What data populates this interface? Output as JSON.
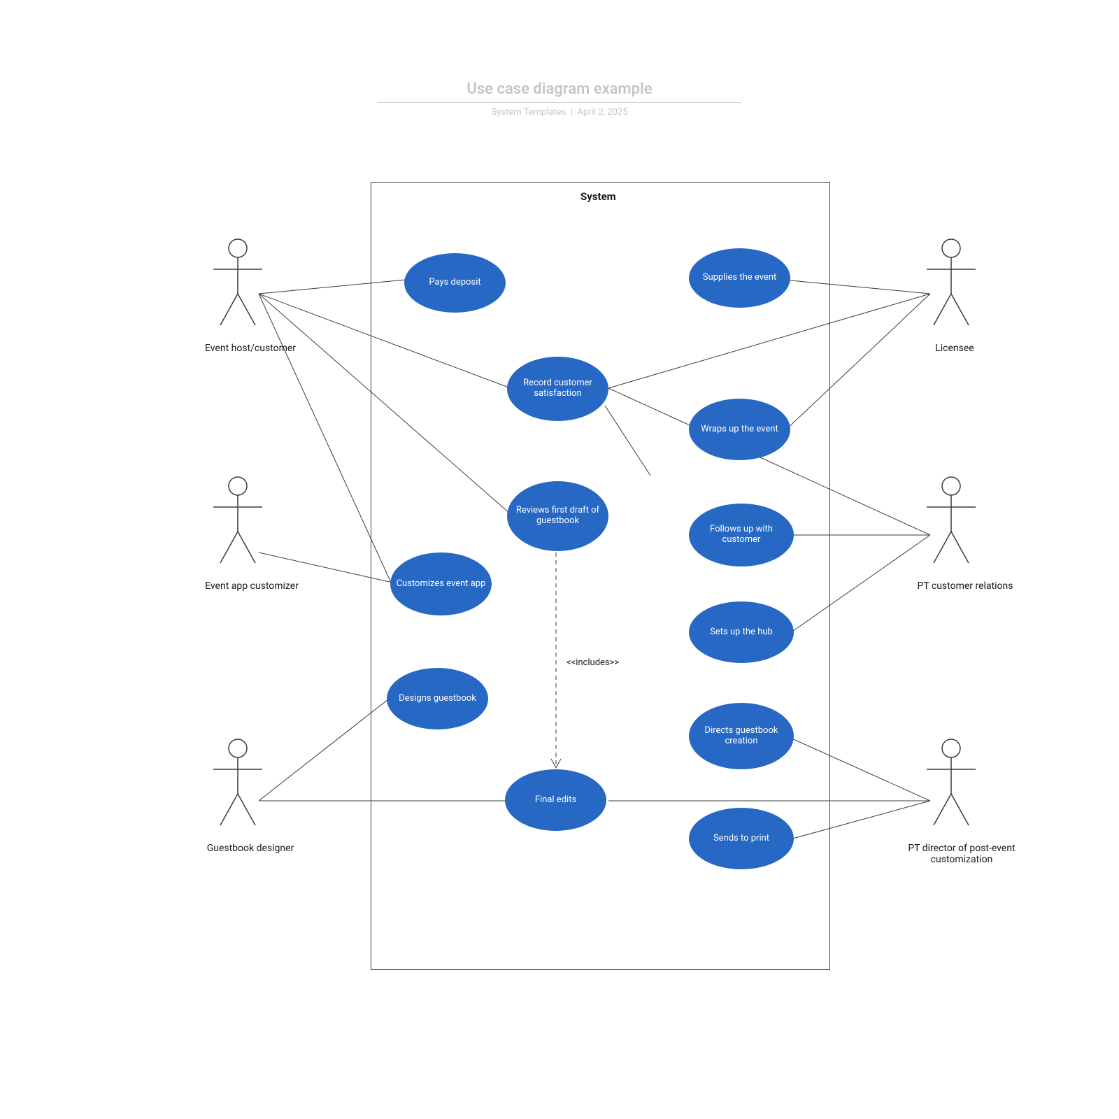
{
  "header": {
    "title": "Use case diagram example",
    "subtitle_source": "System Templates",
    "subtitle_date": "April 2, 2025"
  },
  "system": {
    "label": "System"
  },
  "actors": {
    "event_host": "Event host/customer",
    "event_app_customizer": "Event app customizer",
    "guestbook_designer": "Guestbook designer",
    "licensee": "Licensee",
    "pt_customer_relations": "PT customer relations",
    "pt_director": "PT director of post-event customization"
  },
  "usecases": {
    "pays_deposit": "Pays deposit",
    "supplies_event": "Supplies the event",
    "record_satisfaction": "Record customer satisfaction",
    "wraps_up": "Wraps up the event",
    "reviews_draft": "Reviews first draft of guestbook",
    "follows_up": "Follows up with customer",
    "customizes_app": "Customizes event app",
    "sets_up_hub": "Sets up the hub",
    "designs_guestbook": "Designs guestbook",
    "directs_creation": "Directs guestbook creation",
    "final_edits": "Final edits",
    "sends_print": "Sends to print"
  },
  "relations": {
    "includes": "<<includes>>"
  },
  "colors": {
    "usecase_fill": "#2668c3",
    "stroke": "#3a3a3a"
  }
}
